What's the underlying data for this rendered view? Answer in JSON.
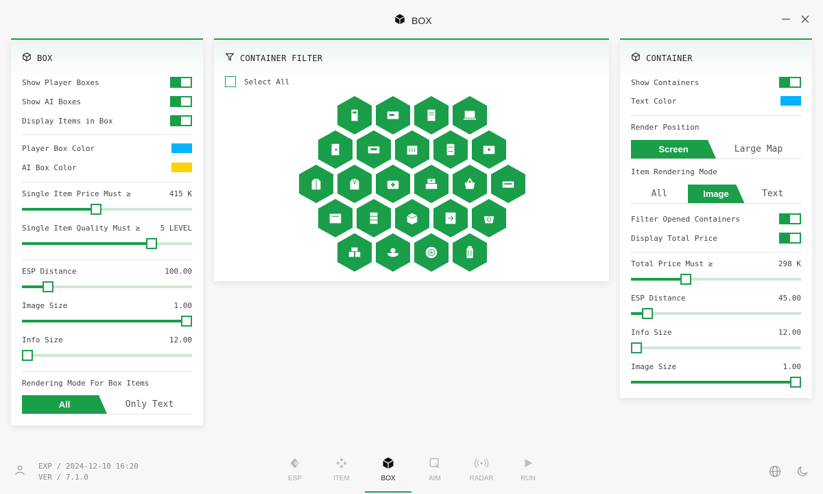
{
  "app": {
    "title": "BOX"
  },
  "colors": {
    "accent": "#1a9e4a",
    "cyan": "#00b4ff",
    "yellow": "#ffd200"
  },
  "left": {
    "title": "BOX",
    "show_player_boxes": "Show Player Boxes",
    "show_ai_boxes": "Show AI Boxes",
    "display_items": "Display Items in Box",
    "player_box_color": "Player Box Color",
    "ai_box_color": "AI Box Color",
    "price_label": "Single Item Price Must ≥",
    "price_value": "415 K",
    "price_fraction": 0.43,
    "quality_label": "Single Item Quality Must ≥",
    "quality_value": "5 LEVEL",
    "quality_fraction": 0.78,
    "esp_label": "ESP Distance",
    "esp_value": "100.00",
    "esp_fraction": 0.13,
    "image_label": "Image Size",
    "image_value": "1.00",
    "image_fraction": 1.0,
    "info_label": "Info Size",
    "info_value": "12.00",
    "info_fraction": 0.0,
    "mode_label": "Rendering Mode For Box Items",
    "mode_options": [
      "All",
      "Only Text"
    ]
  },
  "middle": {
    "title": "CONTAINER FILTER",
    "select_all": "Select All"
  },
  "right": {
    "title": "CONTAINER",
    "show_containers": "Show Containers",
    "text_color": "Text Color",
    "render_position": "Render Position",
    "position_options": [
      "Screen",
      "Large Map"
    ],
    "item_mode": "Item Rendering Mode",
    "item_mode_options": [
      "All",
      "Image",
      "Text"
    ],
    "filter_opened": "Filter Opened Containers",
    "display_total": "Display Total Price",
    "total_label": "Total Price Must ≥",
    "total_value": "298 K",
    "total_fraction": 0.31,
    "esp_label": "ESP Distance",
    "esp_value": "45.00",
    "esp_fraction": 0.07,
    "info_label": "Info Size",
    "info_value": "12.00",
    "info_fraction": 0.0,
    "image_label": "Image Size",
    "image_value": "1.00",
    "image_fraction": 1.0
  },
  "footer": {
    "exp": "EXP / 2024-12-10 16:20",
    "ver": "VER / 7.1.0",
    "nav": [
      "ESP",
      "ITEM",
      "BOX",
      "AIM",
      "RADAR",
      "RUN"
    ]
  }
}
